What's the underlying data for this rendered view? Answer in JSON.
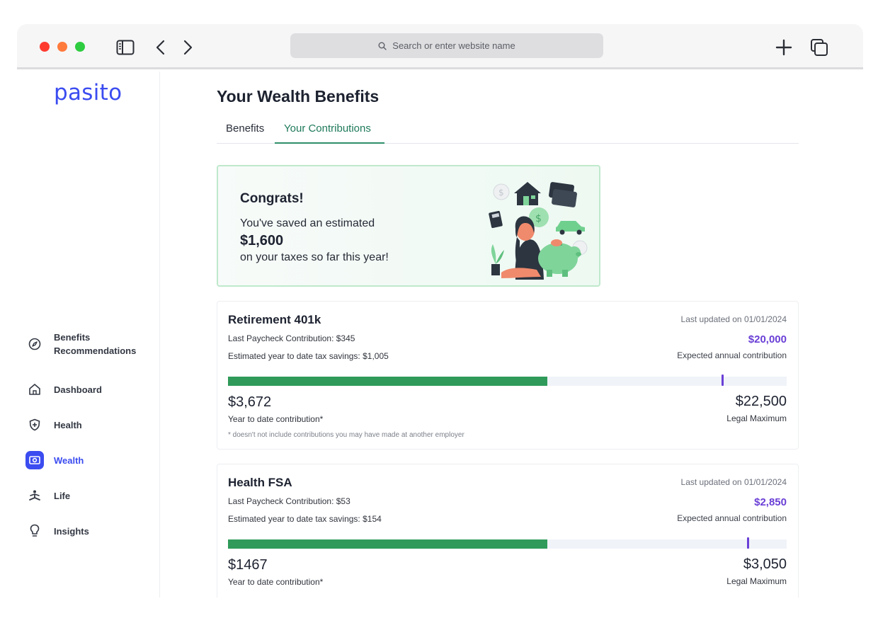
{
  "browser": {
    "address_placeholder": "Search or enter website name"
  },
  "sidebar": {
    "logo": "pasito",
    "items": [
      {
        "label_line1": "Benefits",
        "label_line2": "Recommendations",
        "icon": "compass-icon"
      },
      {
        "label": "Dashboard",
        "icon": "home-icon"
      },
      {
        "label": "Health",
        "icon": "shield-plus-icon"
      },
      {
        "label": "Wealth",
        "icon": "money-icon",
        "active": true
      },
      {
        "label": "Life",
        "icon": "person-meditating-icon"
      },
      {
        "label": "Insights",
        "icon": "lightbulb-icon"
      }
    ]
  },
  "main": {
    "title": "Your Wealth Benefits",
    "tabs": [
      {
        "label": "Benefits"
      },
      {
        "label": "Your Contributions",
        "active": true
      }
    ],
    "congrats": {
      "title": "Congrats!",
      "line1": "You've saved an estimated",
      "amount": "$1,600",
      "line2": "on your taxes so far this year!"
    },
    "cards": [
      {
        "title": "Retirement 401k",
        "last_paycheck": "Last Paycheck Contribution: $345",
        "tax_savings": "Estimated year to date tax savings: $1,005",
        "updated": "Last updated on 01/01/2024",
        "expected_value": "$20,000",
        "expected_label": "Expected annual contribution",
        "progress": {
          "current": 3672,
          "expected": 20000,
          "max": 22500
        },
        "ytd_value": "$3,672",
        "ytd_label": "Year to date contribution*",
        "legal_value": "$22,500",
        "legal_label": "Legal Maximum",
        "footnote": "* doesn't not include contributions you may have made at another employer"
      },
      {
        "title": "Health FSA",
        "last_paycheck": "Last Paycheck Contribution: $53",
        "tax_savings": "Estimated year to date tax savings: $154",
        "updated": "Last updated on 01/01/2024",
        "expected_value": "$2,850",
        "expected_label": "Expected annual contribution",
        "progress": {
          "current": 1467,
          "expected": 2850,
          "max": 3050
        },
        "ytd_value": "$1467",
        "ytd_label": "Year to date contribution*",
        "legal_value": "$3,050",
        "legal_label": "Legal Maximum"
      }
    ]
  },
  "colors": {
    "brand": "#3b4cf0",
    "accent_green": "#2f9a5a",
    "accent_purple": "#6a3fd6"
  }
}
